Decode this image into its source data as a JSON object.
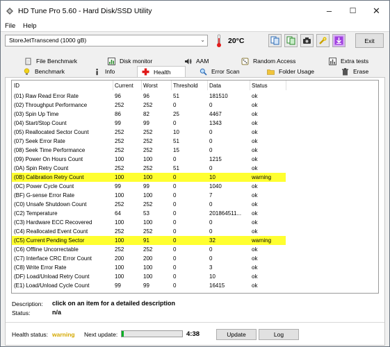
{
  "window": {
    "title": "HD Tune Pro 5.60 - Hard Disk/SSD Utility",
    "minimize": "–",
    "maximize": "☐",
    "close": "✕"
  },
  "menu": {
    "file_label": "File",
    "help_label": "Help"
  },
  "toolbar": {
    "drive": "StoreJetTranscend (1000 gB)",
    "temperature": "20°C",
    "exit_label": "Exit"
  },
  "tabs": {
    "top": [
      {
        "label": "File Benchmark",
        "icon": "file-icon"
      },
      {
        "label": "Disk monitor",
        "icon": "chart-icon"
      },
      {
        "label": "AAM",
        "icon": "speaker-icon"
      },
      {
        "label": "Random Access",
        "icon": "dice-icon"
      },
      {
        "label": "Extra tests",
        "icon": "chart-icon"
      }
    ],
    "bottom": [
      {
        "label": "Benchmark",
        "icon": "bulb-icon"
      },
      {
        "label": "Info",
        "icon": "info-icon"
      },
      {
        "label": "Health",
        "icon": "cross-icon"
      },
      {
        "label": "Error Scan",
        "icon": "magnifier-icon"
      },
      {
        "label": "Folder Usage",
        "icon": "folder-icon"
      },
      {
        "label": "Erase",
        "icon": "trash-icon"
      }
    ]
  },
  "table": {
    "headers": [
      "ID",
      "Current",
      "Worst",
      "Threshold",
      "Data",
      "Status"
    ],
    "rows": [
      {
        "id": "(01) Raw Read Error Rate",
        "current": "96",
        "worst": "96",
        "threshold": "51",
        "data": "181510",
        "status": "ok",
        "warn": false
      },
      {
        "id": "(02) Throughput Performance",
        "current": "252",
        "worst": "252",
        "threshold": "0",
        "data": "0",
        "status": "ok",
        "warn": false
      },
      {
        "id": "(03) Spin Up Time",
        "current": "86",
        "worst": "82",
        "threshold": "25",
        "data": "4467",
        "status": "ok",
        "warn": false
      },
      {
        "id": "(04) Start/Stop Count",
        "current": "99",
        "worst": "99",
        "threshold": "0",
        "data": "1343",
        "status": "ok",
        "warn": false
      },
      {
        "id": "(05) Reallocated Sector Count",
        "current": "252",
        "worst": "252",
        "threshold": "10",
        "data": "0",
        "status": "ok",
        "warn": false
      },
      {
        "id": "(07) Seek Error Rate",
        "current": "252",
        "worst": "252",
        "threshold": "51",
        "data": "0",
        "status": "ok",
        "warn": false
      },
      {
        "id": "(08) Seek Time Performance",
        "current": "252",
        "worst": "252",
        "threshold": "15",
        "data": "0",
        "status": "ok",
        "warn": false
      },
      {
        "id": "(09) Power On Hours Count",
        "current": "100",
        "worst": "100",
        "threshold": "0",
        "data": "1215",
        "status": "ok",
        "warn": false
      },
      {
        "id": "(0A) Spin Retry Count",
        "current": "252",
        "worst": "252",
        "threshold": "51",
        "data": "0",
        "status": "ok",
        "warn": false
      },
      {
        "id": "(0B) Calibration Retry Count",
        "current": "100",
        "worst": "100",
        "threshold": "0",
        "data": "10",
        "status": "warning",
        "warn": true
      },
      {
        "id": "(0C) Power Cycle Count",
        "current": "99",
        "worst": "99",
        "threshold": "0",
        "data": "1040",
        "status": "ok",
        "warn": false
      },
      {
        "id": "(BF) G-sense Error Rate",
        "current": "100",
        "worst": "100",
        "threshold": "0",
        "data": "7",
        "status": "ok",
        "warn": false
      },
      {
        "id": "(C0) Unsafe Shutdown Count",
        "current": "252",
        "worst": "252",
        "threshold": "0",
        "data": "0",
        "status": "ok",
        "warn": false
      },
      {
        "id": "(C2) Temperature",
        "current": "64",
        "worst": "53",
        "threshold": "0",
        "data": "201864511...",
        "status": "ok",
        "warn": false
      },
      {
        "id": "(C3) Hardware ECC Recovered",
        "current": "100",
        "worst": "100",
        "threshold": "0",
        "data": "0",
        "status": "ok",
        "warn": false
      },
      {
        "id": "(C4) Reallocated Event Count",
        "current": "252",
        "worst": "252",
        "threshold": "0",
        "data": "0",
        "status": "ok",
        "warn": false
      },
      {
        "id": "(C5) Current Pending Sector",
        "current": "100",
        "worst": "91",
        "threshold": "0",
        "data": "32",
        "status": "warning",
        "warn": true
      },
      {
        "id": "(C6) Offline Uncorrectable",
        "current": "252",
        "worst": "252",
        "threshold": "0",
        "data": "0",
        "status": "ok",
        "warn": false
      },
      {
        "id": "(C7) Interface CRC Error Count",
        "current": "200",
        "worst": "200",
        "threshold": "0",
        "data": "0",
        "status": "ok",
        "warn": false
      },
      {
        "id": "(C8) Write Error Rate",
        "current": "100",
        "worst": "100",
        "threshold": "0",
        "data": "3",
        "status": "ok",
        "warn": false
      },
      {
        "id": "(DF) Load/Unload Retry Count",
        "current": "100",
        "worst": "100",
        "threshold": "0",
        "data": "10",
        "status": "ok",
        "warn": false
      },
      {
        "id": "(E1) Load/Unload Cycle Count",
        "current": "99",
        "worst": "99",
        "threshold": "0",
        "data": "16415",
        "status": "ok",
        "warn": false
      }
    ]
  },
  "details": {
    "description_label": "Description:",
    "description_value": "click on an item for a detailed description",
    "status_label": "Status:",
    "status_value": "n/a"
  },
  "statusbar": {
    "health_label": "Health status:",
    "health_value": "warning",
    "next_update_label": "Next update:",
    "progress": 0.04,
    "countdown": "4:38",
    "update_label": "Update",
    "log_label": "Log"
  },
  "colors": {
    "warning_highlight": "#ffff30",
    "health_warning_text": "#d4a800",
    "progress_fill": "#06b025"
  }
}
